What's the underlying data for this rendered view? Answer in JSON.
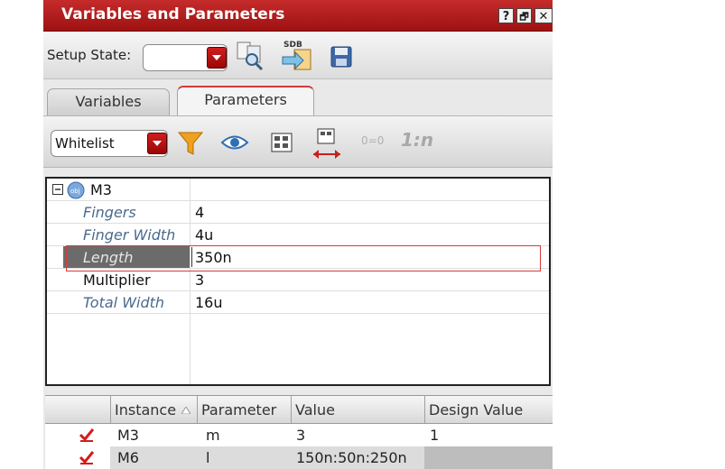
{
  "window": {
    "title": "Variables and Parameters",
    "help": "?",
    "restore": "🗗",
    "close": "✕"
  },
  "setup": {
    "label": "Setup State:",
    "value": ""
  },
  "tabs": [
    {
      "label": "Variables"
    },
    {
      "label": "Parameters"
    }
  ],
  "filter": {
    "value": "Whitelist",
    "ratio_label": "1:n",
    "link_label": "0=0"
  },
  "tree": {
    "instance": "M3",
    "params": [
      {
        "name": "Fingers",
        "value": "4"
      },
      {
        "name": "Finger Width",
        "value": "4u"
      },
      {
        "name": "Length",
        "value": "350n"
      },
      {
        "name": "Multiplier",
        "value": "3"
      },
      {
        "name": "Total Width",
        "value": "16u"
      }
    ]
  },
  "table": {
    "headers": {
      "instance": "Instance",
      "parameter": "Parameter",
      "value": "Value",
      "design": "Design Value"
    },
    "rows": [
      {
        "instance": "M3",
        "parameter": "m",
        "value": "3",
        "design": "1"
      },
      {
        "instance": "M6",
        "parameter": "l",
        "value": "150n:50n:250n",
        "design": ""
      }
    ]
  },
  "colors": {
    "titlebar": "#b31b1b",
    "accent": "#d01e1e",
    "highlight_border": "#d63a3a"
  }
}
